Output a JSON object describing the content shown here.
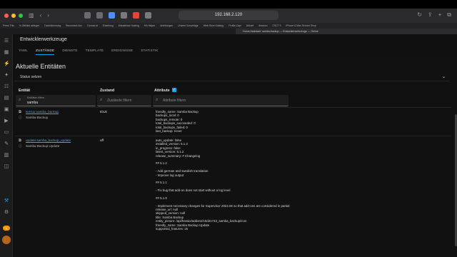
{
  "browser": {
    "url": "192.168.2.120",
    "bookmarks": [
      "Press This",
      "In Zielliste ablegen",
      "Dachdämmung",
      "Beconnect.Acc",
      "Conrad.at",
      "Einleitung",
      "Wanderbar Hosting",
      "HA Helper",
      "Anleitungen",
      "Unsere Vorschläge",
      "Web Store Katalog",
      "Profile-Capi",
      "Aktuell",
      "Amazon",
      "CSCT 9",
      "iPhone & Mac Service Shop"
    ],
    "tab_title": "Home Assistant: samba-backup — Entwicklerwerkzeuge — Online"
  },
  "header": {
    "title": "Entwicklerwerkzeuge",
    "tabs": [
      "YAML",
      "ZUSTÄNDE",
      "DIENSTE",
      "TEMPLATE",
      "EREIGNISSE",
      "STATISTIK"
    ],
    "active_tab": "ZUSTÄNDE"
  },
  "content": {
    "section_title": "Aktuelle Entitäten",
    "set_state_label": "Status setzen",
    "columns": {
      "entity": "Entität",
      "state": "Zustand",
      "attributes": "Attribute"
    },
    "filters": {
      "entity_label": "Entitäten filtern",
      "entity_value": "samba",
      "state_placeholder": "Zustände filtern",
      "attributes_placeholder": "Attribute filtern"
    },
    "rows": [
      {
        "entity_id": "sensor.samba_backup",
        "name": "Samba Backup",
        "state": "IDLE",
        "attributes": [
          "friendly_name: Samba Backup",
          "backups_local: 0",
          "backups_remote: 0",
          "total_backups_succeeded: 0",
          "total_backups_failed: 0",
          "last_backup: never"
        ]
      },
      {
        "entity_id": "update.samba_backup_update",
        "name": "Samba Backup Update",
        "state": "off",
        "attributes": [
          "auto_update: false",
          "installed_version: 5.1.2",
          "in_progress: false",
          "latest_version: 5.1.2",
          "release_summary: # Changelog",
          "",
          "## 5.1.2",
          "",
          "- Add german and swedish translation",
          "- Improve log output",
          "",
          "## 5.1.1",
          "",
          "- Fix bug that add-on does not start without a log level",
          "",
          "## 5.1.0",
          "",
          "- Implement necessary changes for Supervisor 2022.06 so that add-ons are considered in partial",
          "release_url: null",
          "skipped_version: null",
          "title: Samba Backup",
          "entity_picture: /api/hassio/addons/15d21743_samba_backup/icon",
          "friendly_name: Samba Backup Update",
          "supported_features: 25"
        ]
      }
    ]
  },
  "colors": {
    "accent": "#03a9f4",
    "link": "#4aa3df",
    "background": "#111111",
    "sidebar": "#1c1c1c"
  },
  "sidebar_icons": [
    "menu-icon",
    "overview-icon",
    "energy-icon",
    "map-icon",
    "logbook-icon",
    "history-icon",
    "hacs-icon",
    "media-icon",
    "terminal-icon",
    "file-editor-icon",
    "calendar-icon",
    "developer-tools-icon",
    "settings-icon",
    "notifications-icon"
  ],
  "notification_count": "1"
}
